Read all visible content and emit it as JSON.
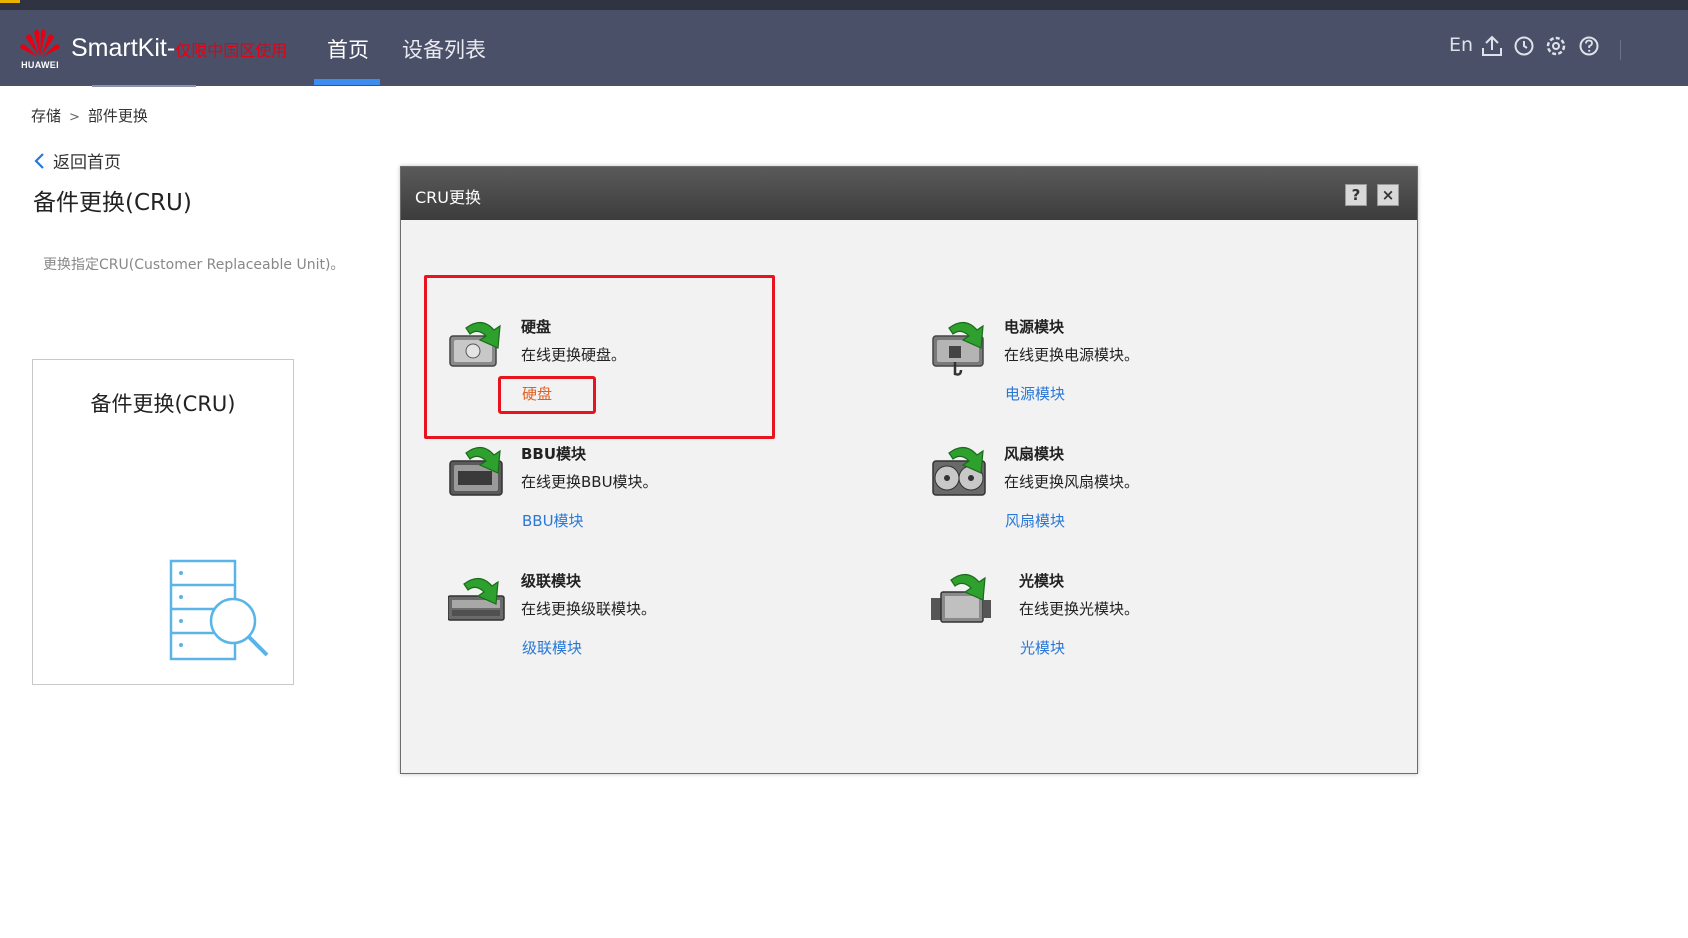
{
  "header": {
    "logo_text": "HUAWEI",
    "brand": "SmartKit-",
    "brand_sub": "仅限中国区使用",
    "nav": [
      "首页",
      "设备列表"
    ],
    "language": "En"
  },
  "breadcrumb": [
    "存储",
    "部件更换"
  ],
  "back_label": "返回首页",
  "page_title": "备件更换(CRU)",
  "page_desc": "更换指定CRU(Customer Replaceable Unit)。",
  "card": {
    "title": "备件更换(CRU)"
  },
  "dialog": {
    "title": "CRU更换",
    "help": "?",
    "close": "×",
    "items": [
      {
        "name": "硬盘",
        "desc": "在线更换硬盘。",
        "link": "硬盘"
      },
      {
        "name": "电源模块",
        "desc": "在线更换电源模块。",
        "link": "电源模块"
      },
      {
        "name": "BBU模块",
        "desc": "在线更换BBU模块。",
        "link": "BBU模块"
      },
      {
        "name": "风扇模块",
        "desc": "在线更换风扇模块。",
        "link": "风扇模块"
      },
      {
        "name": "级联模块",
        "desc": "在线更换级联模块。",
        "link": "级联模块"
      },
      {
        "name": "光模块",
        "desc": "在线更换光模块。",
        "link": "光模块"
      }
    ]
  },
  "colors": {
    "header_bg": "#4a5068",
    "accent": "#3d8cf0",
    "link": "#2a78d6",
    "highlight": "#e8131f",
    "active_link": "#e06020"
  }
}
